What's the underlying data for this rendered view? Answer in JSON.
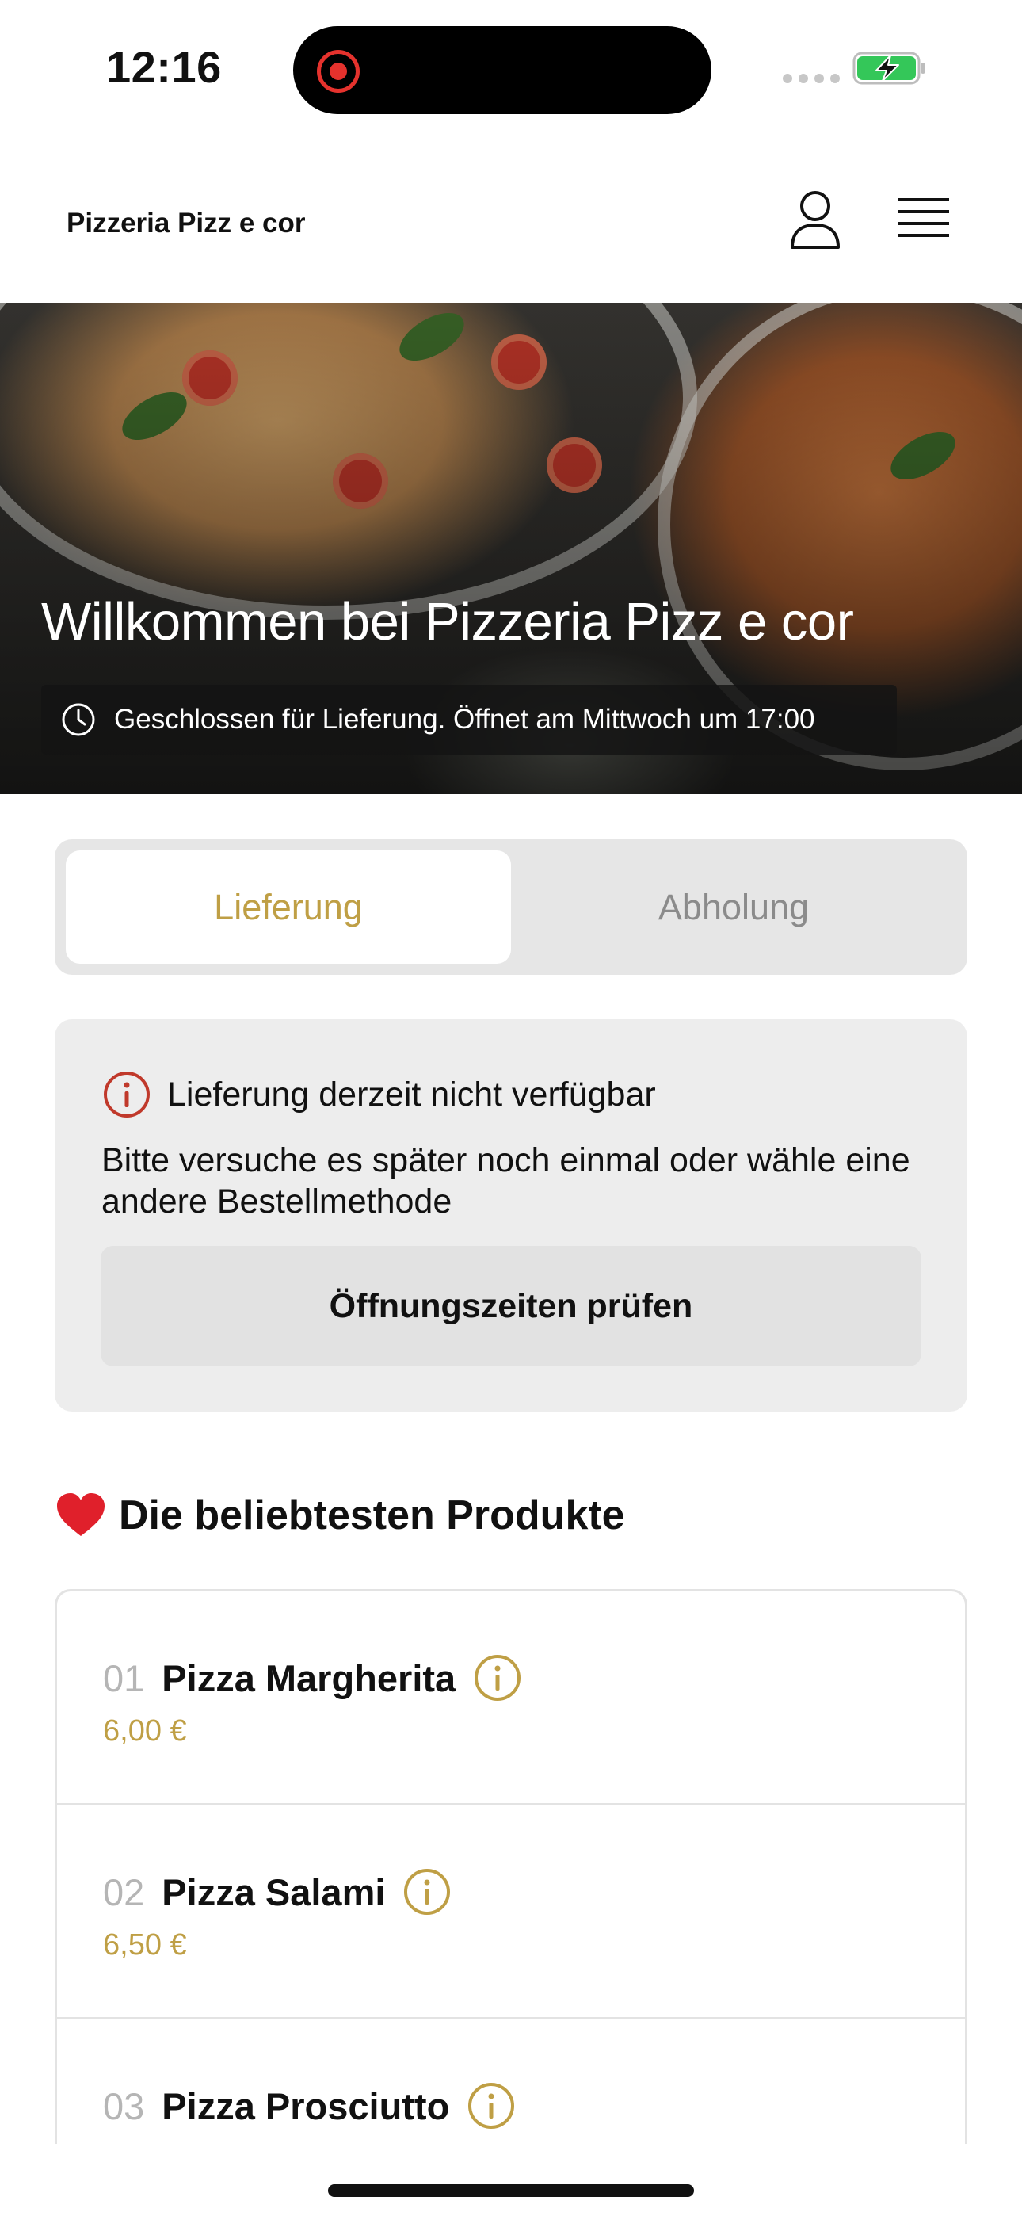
{
  "status_bar": {
    "time": "12:16"
  },
  "header": {
    "brand": "Pizzeria Pizz e cor",
    "user_icon": "user-icon",
    "menu_icon": "hamburger-menu-icon"
  },
  "hero": {
    "title": "Willkommen bei Pizzeria Pizz e cor",
    "closed_text": "Geschlossen für Lieferung. Öffnet am Mittwoch um 17:00"
  },
  "order_mode": {
    "options": [
      "Lieferung",
      "Abholung"
    ],
    "selected": "Lieferung"
  },
  "notice": {
    "title": "Lieferung derzeit nicht verfügbar",
    "body": "Bitte versuche es später noch einmal oder wähle eine andere Bestellmethode",
    "button": "Öffnungszeiten prüfen"
  },
  "popular": {
    "title": "Die beliebtesten Produkte",
    "items": [
      {
        "num": "01",
        "name": "Pizza Margherita",
        "price": "6,00 €"
      },
      {
        "num": "02",
        "name": "Pizza Salami",
        "price": "6,50 €"
      },
      {
        "num": "03",
        "name": "Pizza Prosciutto",
        "price": ""
      }
    ]
  },
  "colors": {
    "accent_gold": "#bf9f45",
    "alert_red": "#c0392b",
    "battery_green": "#34c759"
  }
}
